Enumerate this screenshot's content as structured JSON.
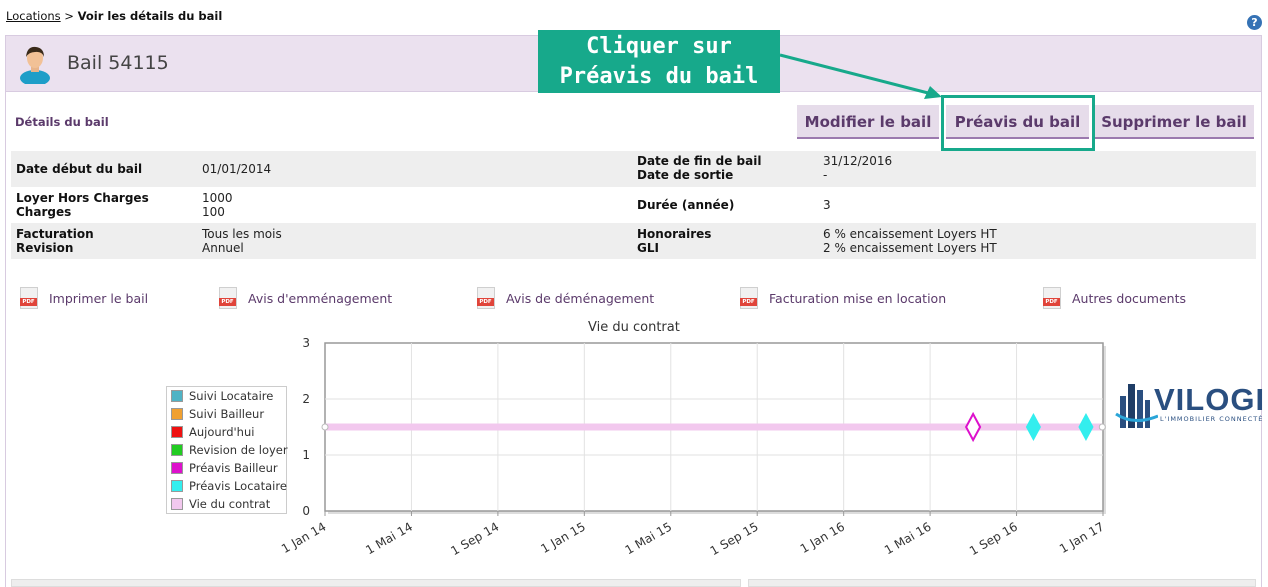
{
  "breadcrumb": {
    "link": "Locations",
    "separator": ">",
    "current": "Voir les détails du bail"
  },
  "help": {
    "label": "?"
  },
  "header": {
    "title": "Bail 54115"
  },
  "annotation": {
    "line1": "Cliquer sur",
    "line2": "Préavis du bail"
  },
  "section": {
    "title": "Détails du bail"
  },
  "actions": {
    "modifier": "Modifier le bail",
    "preavis": "Préavis du bail",
    "supprimer": "Supprimer le bail"
  },
  "details": {
    "row1": {
      "l1": "Date début du bail",
      "v1": "01/01/2014",
      "l2a": "Date de fin de bail",
      "v2a": "31/12/2016",
      "l2b": "Date de sortie",
      "v2b": "-"
    },
    "row2": {
      "l1a": "Loyer Hors Charges",
      "v1a": "1000",
      "l1b": "Charges",
      "v1b": "100",
      "l2": "Durée (année)",
      "v2": "3"
    },
    "row3": {
      "l1a": "Facturation",
      "v1a": "Tous les mois",
      "l1b": "Revision",
      "v1b": "Annuel",
      "l2a": "Honoraires",
      "v2a": "6 % encaissement Loyers HT",
      "l2b": "GLI",
      "v2b": "2 % encaissement Loyers HT"
    }
  },
  "documents": [
    "Imprimer le bail",
    "Avis d'emménagement",
    "Avis de déménagement",
    "Facturation mise en location",
    "Autres documents"
  ],
  "logo": {
    "text": "VILOGI",
    "sub": "L'IMMOBILIER CONNECTÉ"
  },
  "chart_data": {
    "type": "scatter",
    "title": "Vie du contrat",
    "x_tick_labels": [
      "1 Jan 14",
      "1 Mai 14",
      "1 Sep 14",
      "1 Jan 15",
      "1 Mai 15",
      "1 Sep 15",
      "1 Jan 16",
      "1 Mai 16",
      "1 Sep 16",
      "1 Jan 17"
    ],
    "y_tick_labels": [
      "0",
      "1",
      "2",
      "3"
    ],
    "xlim": [
      "2014-01-01",
      "2017-01-01"
    ],
    "ylim": [
      0,
      3
    ],
    "grid": true,
    "legend_position": "left",
    "legend": [
      {
        "name": "Suivi Locataire",
        "color": "#4fb3c5"
      },
      {
        "name": "Suivi Bailleur",
        "color": "#f0a030"
      },
      {
        "name": "Aujourd'hui",
        "color": "#ee1111"
      },
      {
        "name": "Revision de loyer",
        "color": "#22cc22"
      },
      {
        "name": "Préavis Bailleur",
        "color": "#dd11cc"
      },
      {
        "name": "Préavis Locataire",
        "color": "#33eeee"
      },
      {
        "name": "Vie du contrat",
        "color": "#f2c8ee"
      }
    ],
    "series": [
      {
        "name": "Vie du contrat",
        "kind": "band",
        "x": [
          "2014-01-01",
          "2016-12-31"
        ],
        "y": 1.5,
        "color": "#f2c8ee"
      },
      {
        "name": "Préavis Bailleur",
        "kind": "marker",
        "points": [
          {
            "x": "2016-07-02",
            "y": 1.5
          }
        ],
        "color": "#dd11cc"
      },
      {
        "name": "Préavis Locataire",
        "kind": "marker",
        "points": [
          {
            "x": "2016-09-25",
            "y": 1.5
          },
          {
            "x": "2016-12-08",
            "y": 1.5
          }
        ],
        "color": "#33eeee"
      }
    ]
  }
}
